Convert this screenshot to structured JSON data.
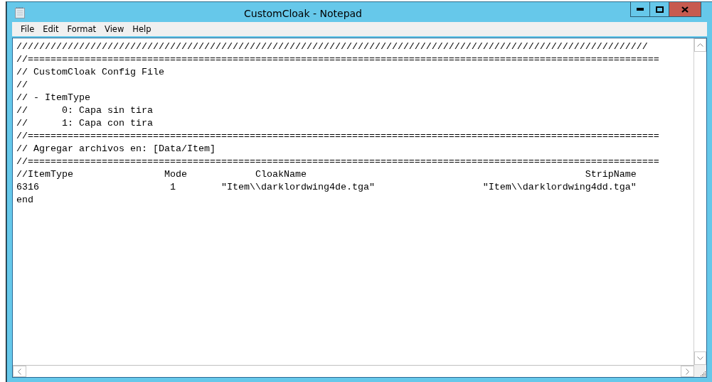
{
  "window": {
    "title": "CustomCloak - Notepad"
  },
  "menu": [
    "File",
    "Edit",
    "Format",
    "View",
    "Help"
  ],
  "editor": {
    "lines": [
      "///////////////////////////////////////////////////////////////////////////////////////////////////////////////",
      "//===============================================================================================================",
      "// CustomCloak Config File",
      "//",
      "// - ItemType",
      "//      0: Capa sin tira",
      "//      1: Capa con tira",
      "//===============================================================================================================",
      "// Agregar archivos en: [Data/Item]",
      "//===============================================================================================================",
      "//ItemType                Mode            CloakName                                                 StripName",
      "6316                       1        \"Item\\\\darklordwing4de.tga\"                   \"Item\\\\darklordwing4dd.tga\"",
      "end"
    ]
  }
}
